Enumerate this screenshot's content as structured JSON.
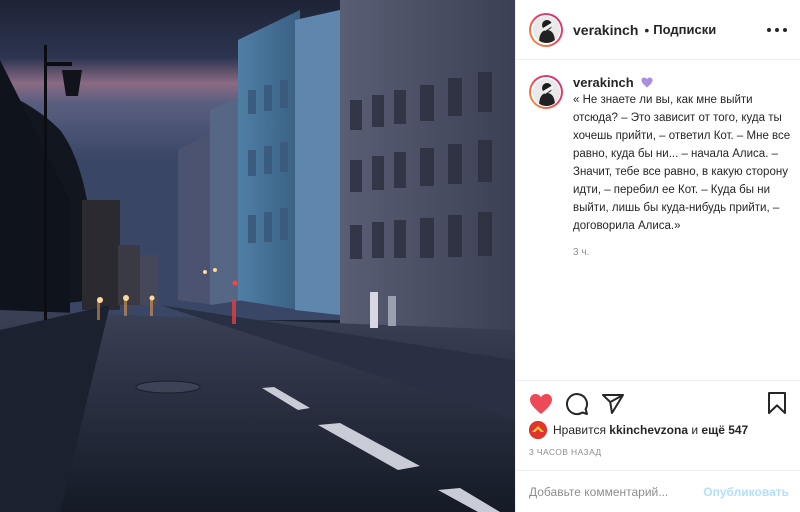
{
  "post": {
    "author": {
      "username": "verakinch",
      "avatar": "avatar-photo"
    },
    "header": {
      "separator": "•",
      "follow_label": "Подписки",
      "more_icon": "more-horizontal-icon"
    },
    "caption": {
      "username": "verakinch",
      "emoji": "purple-heart-emoji",
      "text": "« Не знаете ли вы, как мне выйти отсюда? – Это зависит от того, куда ты хочешь прийти, – ответил Кот. – Мне все равно, куда бы ни... – начала Алиса. – Значит, тебе все равно, в какую сторону идти, – перебил ее Кот. – Куда бы ни выйти, лишь бы куда-нибудь прийти, – договорила Алиса.»",
      "time": "3 ч."
    },
    "actions": {
      "like_icon": "heart-filled-icon",
      "comment_icon": "comment-icon",
      "share_icon": "share-icon",
      "save_icon": "bookmark-icon",
      "like_color": "#ed4956"
    },
    "likes": {
      "prefix": "Нравится",
      "user": "kkinchevzona",
      "connector": "и",
      "others": "ещё 547"
    },
    "timestamp": "3 часов назад",
    "comment": {
      "placeholder": "Добавьте комментарий...",
      "publish_label": "Опубликовать"
    }
  }
}
